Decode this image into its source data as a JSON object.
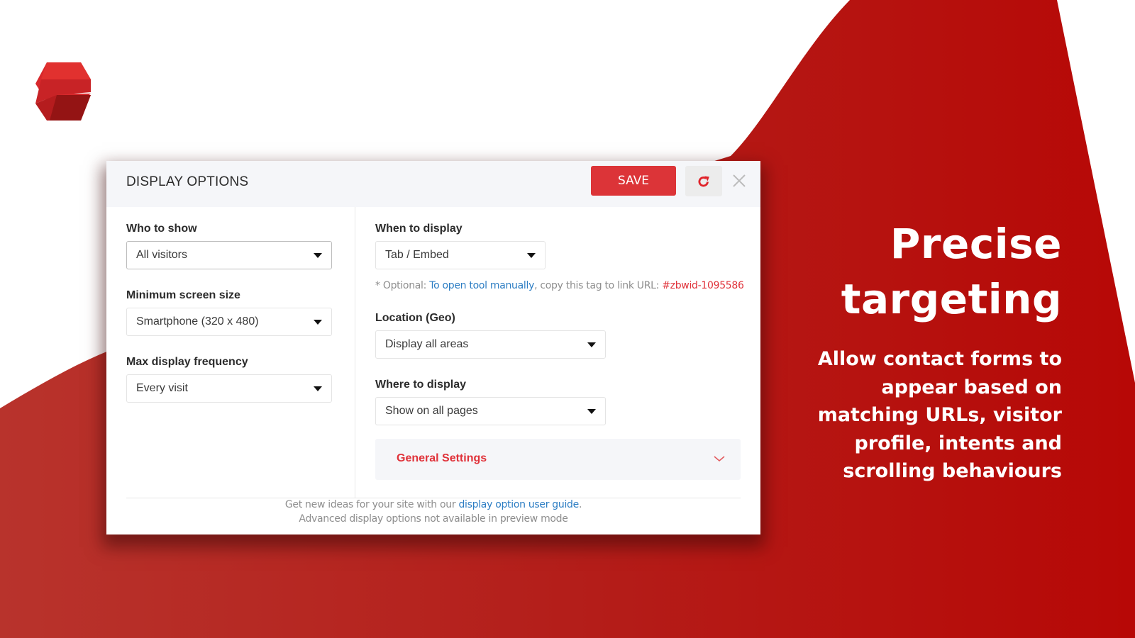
{
  "brand": {
    "logo_icon": "z-logo-icon",
    "accent_color": "#dc3438",
    "background_red": "#b5100e",
    "link_color": "#2c7dc3"
  },
  "panel": {
    "title": "DISPLAY OPTIONS",
    "save_label": "SAVE",
    "refresh_icon": "refresh-icon",
    "close_icon": "close-icon"
  },
  "left_column": {
    "who_to_show": {
      "label": "Who to show",
      "value": "All visitors"
    },
    "min_screen_size": {
      "label": "Minimum screen size",
      "value": "Smartphone (320 x 480)"
    },
    "max_frequency": {
      "label": "Max display frequency",
      "value": "Every visit"
    }
  },
  "right_column": {
    "when_to_display": {
      "label": "When to display",
      "value": "Tab / Embed"
    },
    "hint": {
      "prefix": "* Optional: ",
      "link": "To open tool manually",
      "middle": ", copy this tag to link URL: ",
      "tag": "#zbwid-1095586"
    },
    "location": {
      "label": "Location (Geo)",
      "value": "Display all areas"
    },
    "where_to_display": {
      "label": "Where to display",
      "value": "Show on all pages"
    },
    "general_settings": {
      "label": "General Settings",
      "icon": "chevron-down-icon"
    }
  },
  "footer": {
    "line1_prefix": "Get new ideas for your site with our ",
    "line1_link": "display option user guide",
    "line1_suffix": ".",
    "line2": "Advanced display options not available in preview mode"
  },
  "promo": {
    "title_line1": "Precise",
    "title_line2": "targeting",
    "body_lines": [
      "Allow contact forms to",
      "appear based on",
      "matching URLs, visitor",
      "profile, intents and",
      "scrolling behaviours"
    ]
  }
}
